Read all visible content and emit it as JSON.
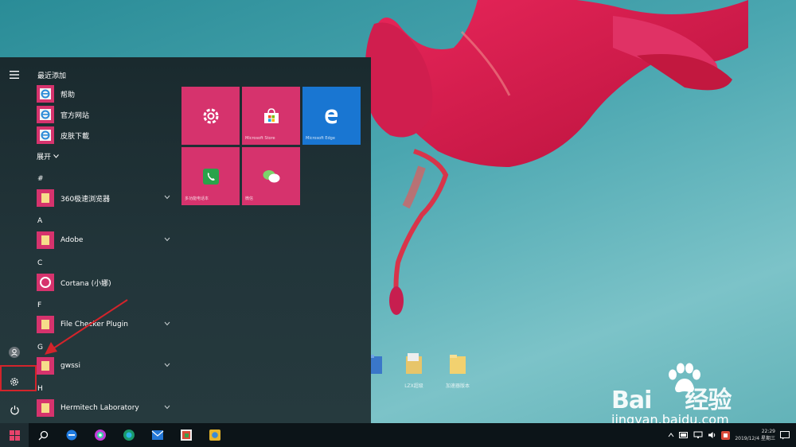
{
  "start_menu": {
    "recent_header": "最近添加",
    "recent_apps": [
      {
        "name": "帮助"
      },
      {
        "name": "官方网站"
      },
      {
        "name": "皮肤下載"
      }
    ],
    "expand_label": "展开",
    "sections": [
      {
        "letter": "#",
        "app": "360极速浏览器",
        "has_chevron": true
      },
      {
        "letter": "A",
        "app": "Adobe",
        "has_chevron": true
      },
      {
        "letter": "C",
        "app": "Cortana (小娜)",
        "has_chevron": false
      },
      {
        "letter": "F",
        "app": "File Checker Plugin",
        "has_chevron": true
      },
      {
        "letter": "G",
        "app": "gwssi",
        "has_chevron": true
      },
      {
        "letter": "H",
        "app": "Hermitech Laboratory",
        "has_chevron": true
      }
    ],
    "rail": {
      "menu_icon": "hamburger-icon",
      "user_icon": "user-icon",
      "settings_icon": "gear-icon",
      "power_icon": "power-icon"
    },
    "tiles": [
      {
        "label": "",
        "icon": "gear-icon",
        "color": "#d6336d"
      },
      {
        "label": "Microsoft Store",
        "icon": "store-icon",
        "color": "#d6336d"
      },
      {
        "label": "Microsoft Edge",
        "icon": "edge-icon",
        "color": "#1976d2"
      },
      {
        "label": "多功能电话本",
        "icon": "phone-icon",
        "color": "#d6336d"
      },
      {
        "label": "微信",
        "icon": "wechat-icon",
        "color": "#d6336d"
      }
    ]
  },
  "desktop_icons": [
    {
      "label": "",
      "icon": "folder-icon"
    },
    {
      "label": "LZX超级",
      "icon": "folder-icon"
    },
    {
      "label": "加速器版本",
      "icon": "folder-icon"
    }
  ],
  "taskbar": {
    "clock_time": "22:29",
    "clock_date": "2019/12/4 星期三"
  },
  "watermark": {
    "brand": "Bai",
    "brand_cn": "经验",
    "url": "jingyan.baidu.com"
  },
  "colors": {
    "accent_tile": "#d6336d",
    "edge_tile": "#1976d2",
    "annotation_red": "#d3242b"
  }
}
